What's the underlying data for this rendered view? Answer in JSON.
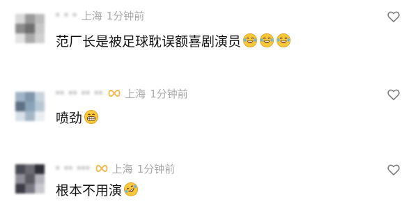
{
  "comments": [
    {
      "username": "·  ·   ·",
      "location": "上海",
      "time": "1分钟前",
      "text": "范厂长是被足球耽误额喜剧演员",
      "emojis": [
        "laugh-cry",
        "laugh-cry",
        "laugh-cry"
      ],
      "avatar_colors": [
        "#d9d9d9",
        "#9a9a9a",
        "#bdbdbd",
        "#8c8c8c",
        "#6f6f6f",
        "#c7c7c7",
        "#e3e3e3",
        "#a9a9a9",
        "#d0d0d0"
      ]
    },
    {
      "username": "·· ·· ··  ··",
      "location": "上海",
      "time": "1分钟前",
      "text": "喷劲",
      "emojis": [
        "grin"
      ],
      "avatar_colors": [
        "#9fb4c6",
        "#7f96ab",
        "#c7d4de",
        "#5e7184",
        "#8aa2b7",
        "#b6c6d3",
        "#d8e1e8",
        "#a5b7c6",
        "#e9eef2"
      ]
    },
    {
      "username": "· ·· ···",
      "location": "上海",
      "time": "1分钟前",
      "text": "根本不用演",
      "emojis": [
        "laugh-rolling"
      ],
      "avatar_colors": [
        "#4a4a52",
        "#6c6b74",
        "#2f2f36",
        "#8f8e97",
        "#5b5a63",
        "#b4b3ba",
        "#3d3c44",
        "#7a7983",
        "#c9c8ce"
      ]
    }
  ],
  "colors": {
    "text": "#141414",
    "meta": "#a8a8a8",
    "badge": "#f2b64a",
    "like": "#777777"
  },
  "icons": {
    "badge": "infinity-badge-icon",
    "like": "heart-outline-icon"
  }
}
